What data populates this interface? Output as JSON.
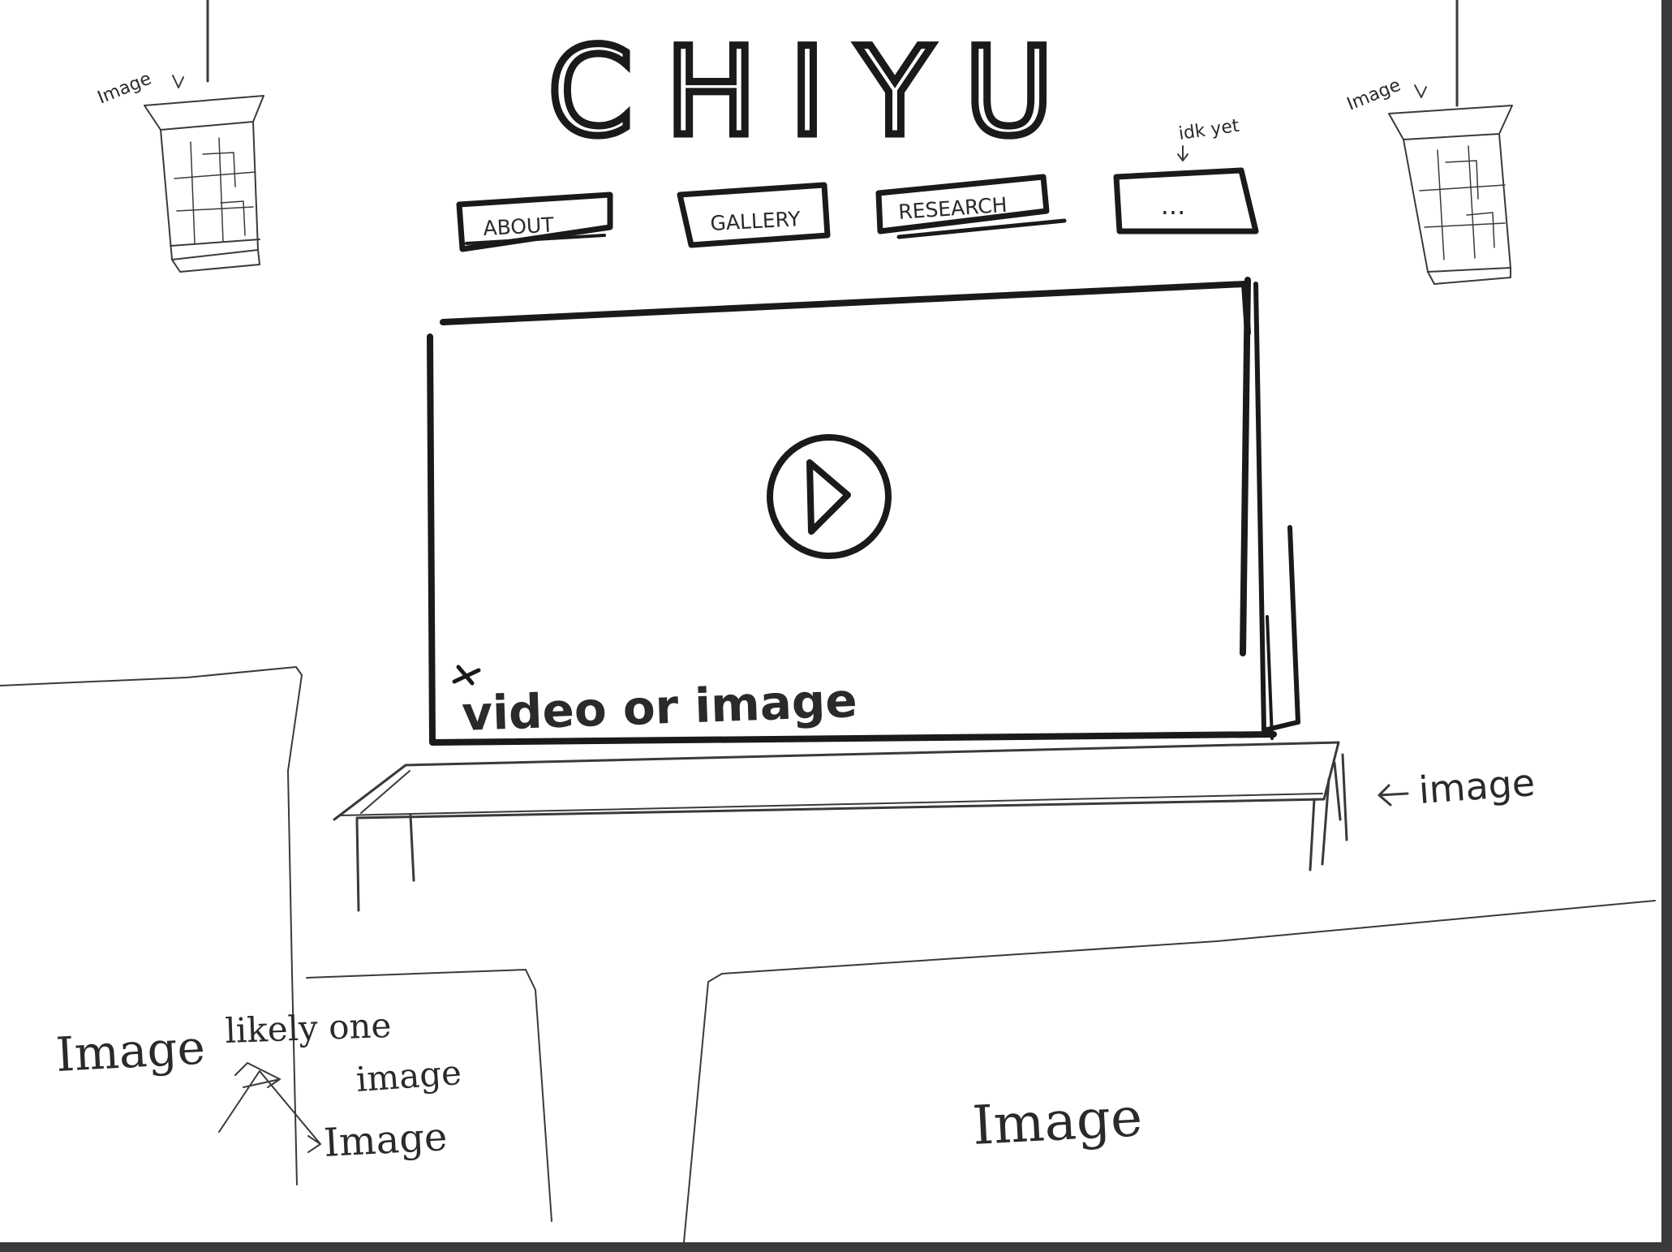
{
  "site": {
    "title": "CHIYU"
  },
  "nav": {
    "items": [
      {
        "label": "ABOUT"
      },
      {
        "label": "GALLERY"
      },
      {
        "label": "RESEARCH"
      },
      {
        "label": "..."
      }
    ],
    "more_note": "idk yet"
  },
  "annotations": {
    "lantern_left": "Image",
    "lantern_right": "Image",
    "hero": "video or image",
    "bench": "image",
    "bottom_left": "Image",
    "likely_one": "likely one",
    "image_word": "image",
    "bottom_mid": "Image",
    "bottom_right": "Image"
  },
  "hero": {
    "icon": "play-icon"
  }
}
